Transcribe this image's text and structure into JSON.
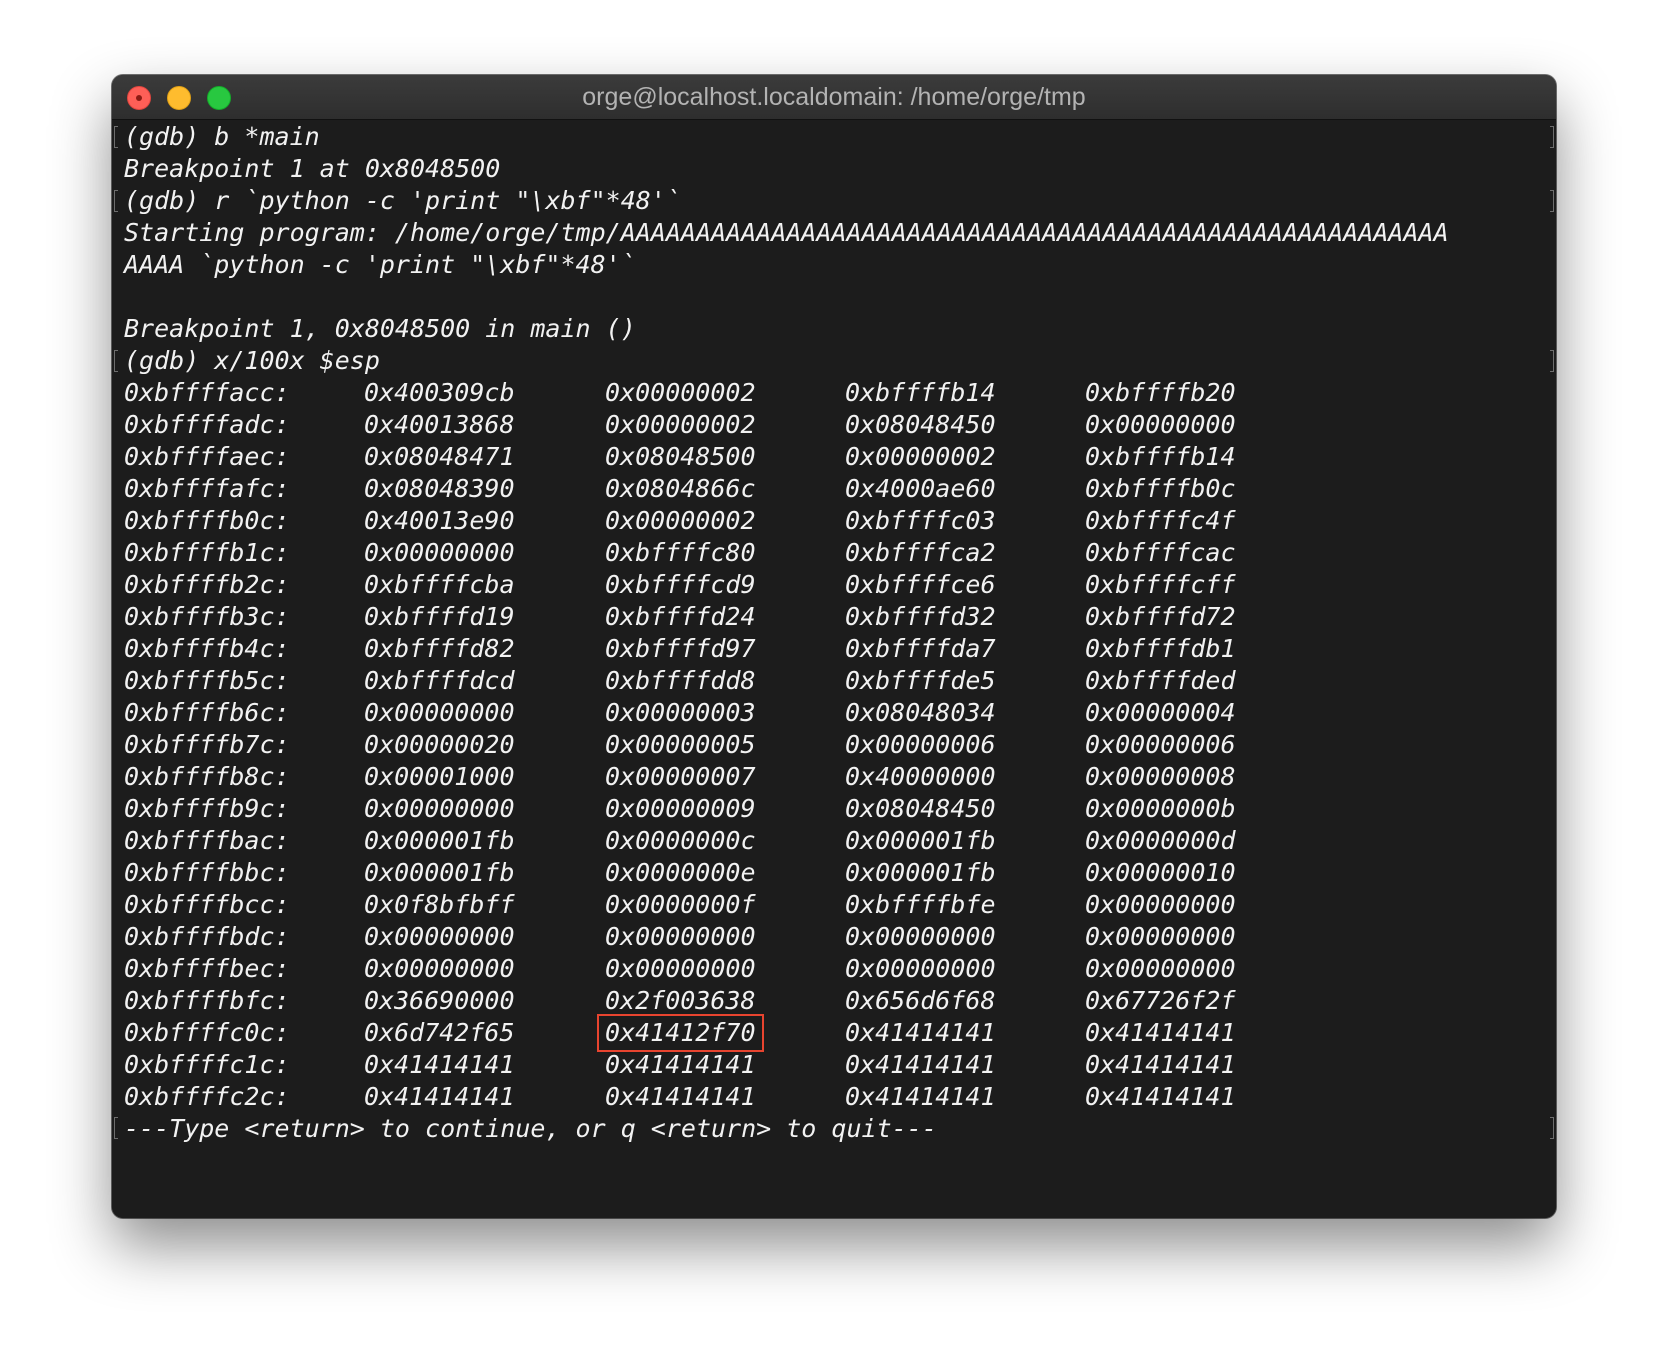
{
  "window": {
    "title": "orge@localhost.localdomain: /home/orge/tmp"
  },
  "terminal": {
    "pre_lines": [
      "(gdb) b *main",
      "Breakpoint 1 at 0x8048500",
      "(gdb) r `python -c 'print \"\\xbf\"*48'`",
      "Starting program: /home/orge/tmp/AAAAAAAAAAAAAAAAAAAAAAAAAAAAAAAAAAAAAAAAAAAAAAAAAAAAAAA",
      "AAAA `python -c 'print \"\\xbf\"*48'`",
      "",
      "Breakpoint 1, 0x8048500 in main ()",
      "(gdb) x/100x $esp"
    ],
    "memory_rows": [
      [
        "0xbffffacc:",
        "0x400309cb",
        "0x00000002",
        "0xbffffb14",
        "0xbffffb20"
      ],
      [
        "0xbffffadc:",
        "0x40013868",
        "0x00000002",
        "0x08048450",
        "0x00000000"
      ],
      [
        "0xbffffaec:",
        "0x08048471",
        "0x08048500",
        "0x00000002",
        "0xbffffb14"
      ],
      [
        "0xbffffafc:",
        "0x08048390",
        "0x0804866c",
        "0x4000ae60",
        "0xbffffb0c"
      ],
      [
        "0xbffffb0c:",
        "0x40013e90",
        "0x00000002",
        "0xbffffc03",
        "0xbffffc4f"
      ],
      [
        "0xbffffb1c:",
        "0x00000000",
        "0xbffffc80",
        "0xbffffca2",
        "0xbffffcac"
      ],
      [
        "0xbffffb2c:",
        "0xbffffcba",
        "0xbffffcd9",
        "0xbffffce6",
        "0xbffffcff"
      ],
      [
        "0xbffffb3c:",
        "0xbffffd19",
        "0xbffffd24",
        "0xbffffd32",
        "0xbffffd72"
      ],
      [
        "0xbffffb4c:",
        "0xbffffd82",
        "0xbffffd97",
        "0xbffffda7",
        "0xbffffdb1"
      ],
      [
        "0xbffffb5c:",
        "0xbffffdcd",
        "0xbffffdd8",
        "0xbffffde5",
        "0xbffffded"
      ],
      [
        "0xbffffb6c:",
        "0x00000000",
        "0x00000003",
        "0x08048034",
        "0x00000004"
      ],
      [
        "0xbffffb7c:",
        "0x00000020",
        "0x00000005",
        "0x00000006",
        "0x00000006"
      ],
      [
        "0xbffffb8c:",
        "0x00001000",
        "0x00000007",
        "0x40000000",
        "0x00000008"
      ],
      [
        "0xbffffb9c:",
        "0x00000000",
        "0x00000009",
        "0x08048450",
        "0x0000000b"
      ],
      [
        "0xbffffbac:",
        "0x000001fb",
        "0x0000000c",
        "0x000001fb",
        "0x0000000d"
      ],
      [
        "0xbffffbbc:",
        "0x000001fb",
        "0x0000000e",
        "0x000001fb",
        "0x00000010"
      ],
      [
        "0xbffffbcc:",
        "0x0f8bfbff",
        "0x0000000f",
        "0xbffffbfe",
        "0x00000000"
      ],
      [
        "0xbffffbdc:",
        "0x00000000",
        "0x00000000",
        "0x00000000",
        "0x00000000"
      ],
      [
        "0xbffffbec:",
        "0x00000000",
        "0x00000000",
        "0x00000000",
        "0x00000000"
      ],
      [
        "0xbffffbfc:",
        "0x36690000",
        "0x2f003638",
        "0x656d6f68",
        "0x67726f2f"
      ],
      [
        "0xbffffc0c:",
        "0x6d742f65",
        "0x41412f70",
        "0x41414141",
        "0x41414141"
      ],
      [
        "0xbffffc1c:",
        "0x41414141",
        "0x41414141",
        "0x41414141",
        "0x41414141"
      ],
      [
        "0xbffffc2c:",
        "0x41414141",
        "0x41414141",
        "0x41414141",
        "0x41414141"
      ]
    ],
    "highlight": {
      "row": 20,
      "col": 1,
      "color": "#e8442f"
    },
    "pager_prompt": "---Type <return> to continue, or q <return> to quit---"
  },
  "colors": {
    "background": "#1c1c1c",
    "text": "#f2f2f2",
    "close": "#fe5f57",
    "minimize": "#febc2e",
    "maximize": "#28c840"
  }
}
